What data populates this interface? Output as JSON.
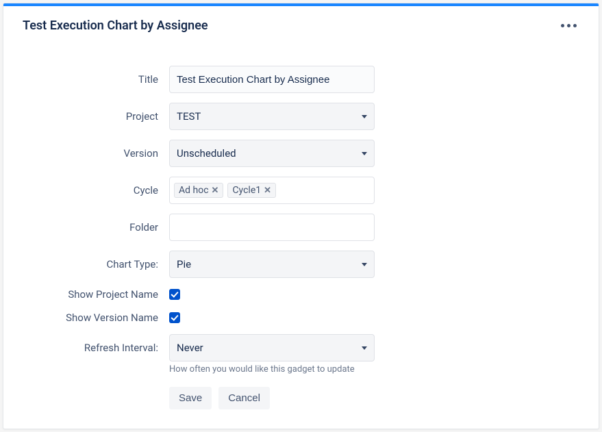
{
  "header": {
    "title": "Test Execution Chart by Assignee"
  },
  "form": {
    "title": {
      "label": "Title",
      "value": "Test Execution Chart by Assignee"
    },
    "project": {
      "label": "Project",
      "selected": "TEST"
    },
    "version": {
      "label": "Version",
      "selected": "Unscheduled"
    },
    "cycle": {
      "label": "Cycle",
      "tags": [
        "Ad hoc",
        "Cycle1"
      ]
    },
    "folder": {
      "label": "Folder",
      "value": ""
    },
    "chart_type": {
      "label": "Chart Type:",
      "selected": "Pie"
    },
    "show_project": {
      "label": "Show Project Name",
      "checked": true
    },
    "show_version": {
      "label": "Show Version Name",
      "checked": true
    },
    "refresh": {
      "label": "Refresh Interval:",
      "selected": "Never",
      "help": "How often you would like this gadget to update"
    }
  },
  "buttons": {
    "save": "Save",
    "cancel": "Cancel"
  }
}
